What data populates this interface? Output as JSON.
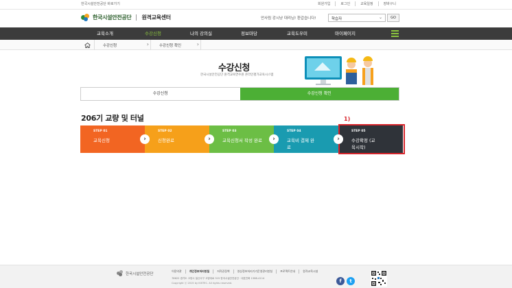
{
  "util_bar": {
    "left_link": "한국시설안전공단 바로가기",
    "links": [
      "회원가입",
      "로그인",
      "교육일정",
      "장바구니"
    ]
  },
  "header": {
    "logo_text": "한국시설안전공단",
    "logo_sub": "원격교육센터",
    "welcome": "안사림 강시냥 대리님! 환갑습니다!",
    "select_value": "학습자",
    "go_label": "GO"
  },
  "nav": {
    "items": [
      "교육소개",
      "수강신청",
      "나의 강의실",
      "정보마당",
      "교육도우미",
      "마이페이지"
    ],
    "active_index": 1
  },
  "breadcrumb": {
    "items": [
      "수강신청",
      "수강신청 확인"
    ]
  },
  "page": {
    "title": "수강신청",
    "subtitle": "한국시설안전공단 원격교육연수원 온라인평가교육시스템"
  },
  "tabs": {
    "items": [
      "수강신청",
      "수강신청 확인"
    ],
    "active_index": 1
  },
  "course": {
    "title": "206기 교량 및 터널",
    "annotation": "1)"
  },
  "steps": [
    {
      "no": "STEP 01",
      "text": "교육신청"
    },
    {
      "no": "STEP 02",
      "text": "신청완료"
    },
    {
      "no": "STEP 03",
      "text": "교육신청서 작성 완료"
    },
    {
      "no": "STEP 04",
      "text": "교육비 결제 완료"
    },
    {
      "no": "STEP 05",
      "text": "수강확정 (교육시작)"
    }
  ],
  "footer": {
    "logo_text": "한국시설안전공단",
    "links": [
      "이용약관",
      "개인정보처리방침",
      "저작권정책",
      "영상정보처리기기운영관리방침",
      "프로젝트안내",
      "원격교육시설"
    ],
    "bold_index": 1,
    "address": "78622 경기도 고양시 일산서구 고양대로 315 한국시설안전공단 · 대표전화 1588-4114",
    "copyright": "Copyright ⓒ 2015 by KISTEC. All rights reserved."
  },
  "colors": {
    "nav_bg": "#3c3c3c",
    "accent_green": "#4caf35",
    "step1": "#f26522",
    "step2": "#f6a01a",
    "step3": "#6cbe45",
    "step4": "#1a9bb0",
    "step5": "#2f3339",
    "annotation_red": "#d8232a"
  }
}
